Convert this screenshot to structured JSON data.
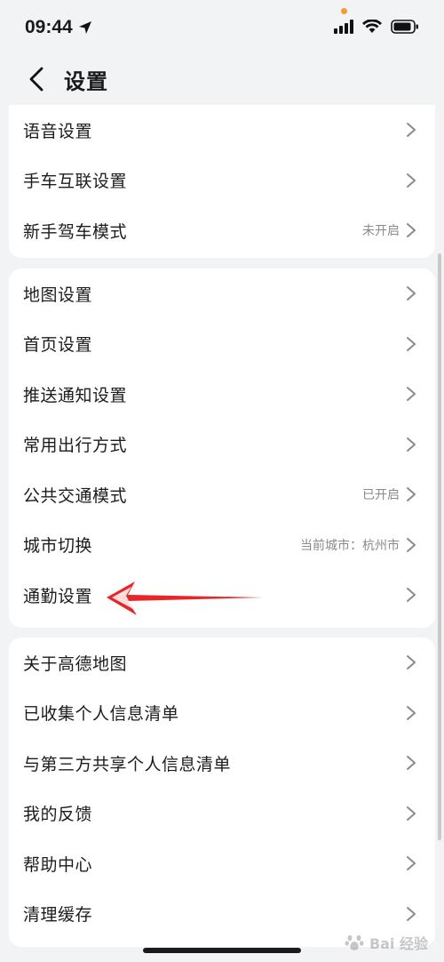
{
  "status_bar": {
    "time": "09:44",
    "accent_dot_color": "#f29c38"
  },
  "nav": {
    "title": "设置"
  },
  "group1": [
    {
      "label": "语音设置",
      "value": ""
    },
    {
      "label": "手车互联设置",
      "value": ""
    },
    {
      "label": "新手驾车模式",
      "value": "未开启"
    }
  ],
  "group2": [
    {
      "label": "地图设置",
      "value": ""
    },
    {
      "label": "首页设置",
      "value": ""
    },
    {
      "label": "推送通知设置",
      "value": ""
    },
    {
      "label": "常用出行方式",
      "value": ""
    },
    {
      "label": "公共交通模式",
      "value": "已开启"
    },
    {
      "label": "城市切换",
      "value": "当前城市：杭州市"
    },
    {
      "label": "通勤设置",
      "value": ""
    }
  ],
  "group3": [
    {
      "label": "关于高德地图",
      "value": ""
    },
    {
      "label": "已收集个人信息清单",
      "value": ""
    },
    {
      "label": "与第三方共享个人信息清单",
      "value": ""
    },
    {
      "label": "我的反馈",
      "value": ""
    },
    {
      "label": "帮助中心",
      "value": ""
    },
    {
      "label": "清理缓存",
      "value": ""
    }
  ],
  "annotation_color": "#e8262a",
  "watermark": "Bai 经验"
}
